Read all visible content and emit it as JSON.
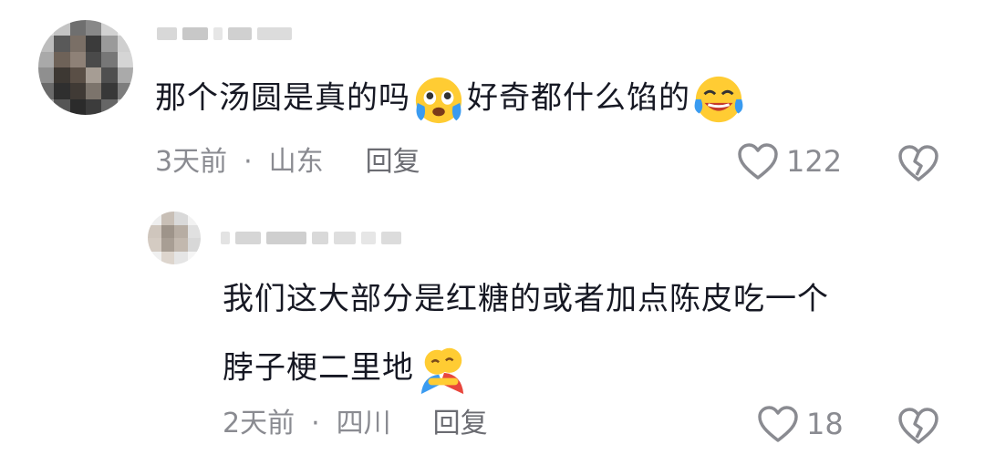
{
  "comments": [
    {
      "text_part1": "那个汤圆是真的吗",
      "emoji1": "crying-face-emoji",
      "text_part2": "好奇都什么馅的",
      "emoji2": "laughing-crying-emoji",
      "time": "3天前",
      "separator": "·",
      "location": "山东",
      "reply_label": "回复",
      "like_count": "122",
      "like_icon": "heart-outline-icon",
      "dislike_icon": "broken-heart-icon"
    },
    {
      "text_line1": "我们这大部分是红糖的或者加点陈皮吃一个",
      "text_line2": "脖子梗二里地",
      "emoji": "hugging-face-emoji",
      "time": "2天前",
      "separator": "·",
      "location": "四川",
      "reply_label": "回复",
      "like_count": "18",
      "like_icon": "heart-outline-icon",
      "dislike_icon": "broken-heart-icon"
    }
  ],
  "colors": {
    "text": "#161823",
    "meta": "#8a8b91",
    "emoji_yellow": "#ffcc33",
    "emoji_tear": "#3a9bf0",
    "hug_red": "#e8463c"
  }
}
